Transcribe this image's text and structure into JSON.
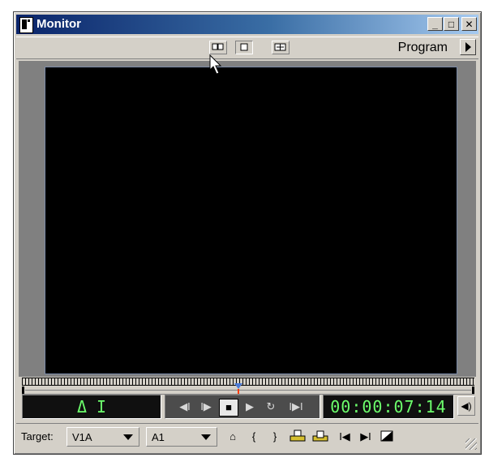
{
  "window": {
    "title": "Monitor"
  },
  "titlebar_buttons": {
    "minimize": "_",
    "maximize": "□",
    "close": "✕"
  },
  "toolbar": {
    "program_label": "Program"
  },
  "display": {
    "delta": "Δ I",
    "timecode": "00:00:07:14"
  },
  "transport": {
    "prev_edit": "◀I",
    "step_back": "I▶",
    "stop": "■",
    "play": "▶",
    "loop": "↻",
    "next_edit": "I▶I"
  },
  "bottom": {
    "target_label": "Target:",
    "video_target": "V1A",
    "audio_target": "A1",
    "lift": "⌂",
    "mark_in": "{",
    "mark_out": "}",
    "go_in": "I◀",
    "go_out": "▶I"
  },
  "colors": {
    "lcd_text": "#6cff6c",
    "title_start": "#0a246a",
    "title_end": "#a6caf0",
    "playhead": "#4a7ad8"
  }
}
